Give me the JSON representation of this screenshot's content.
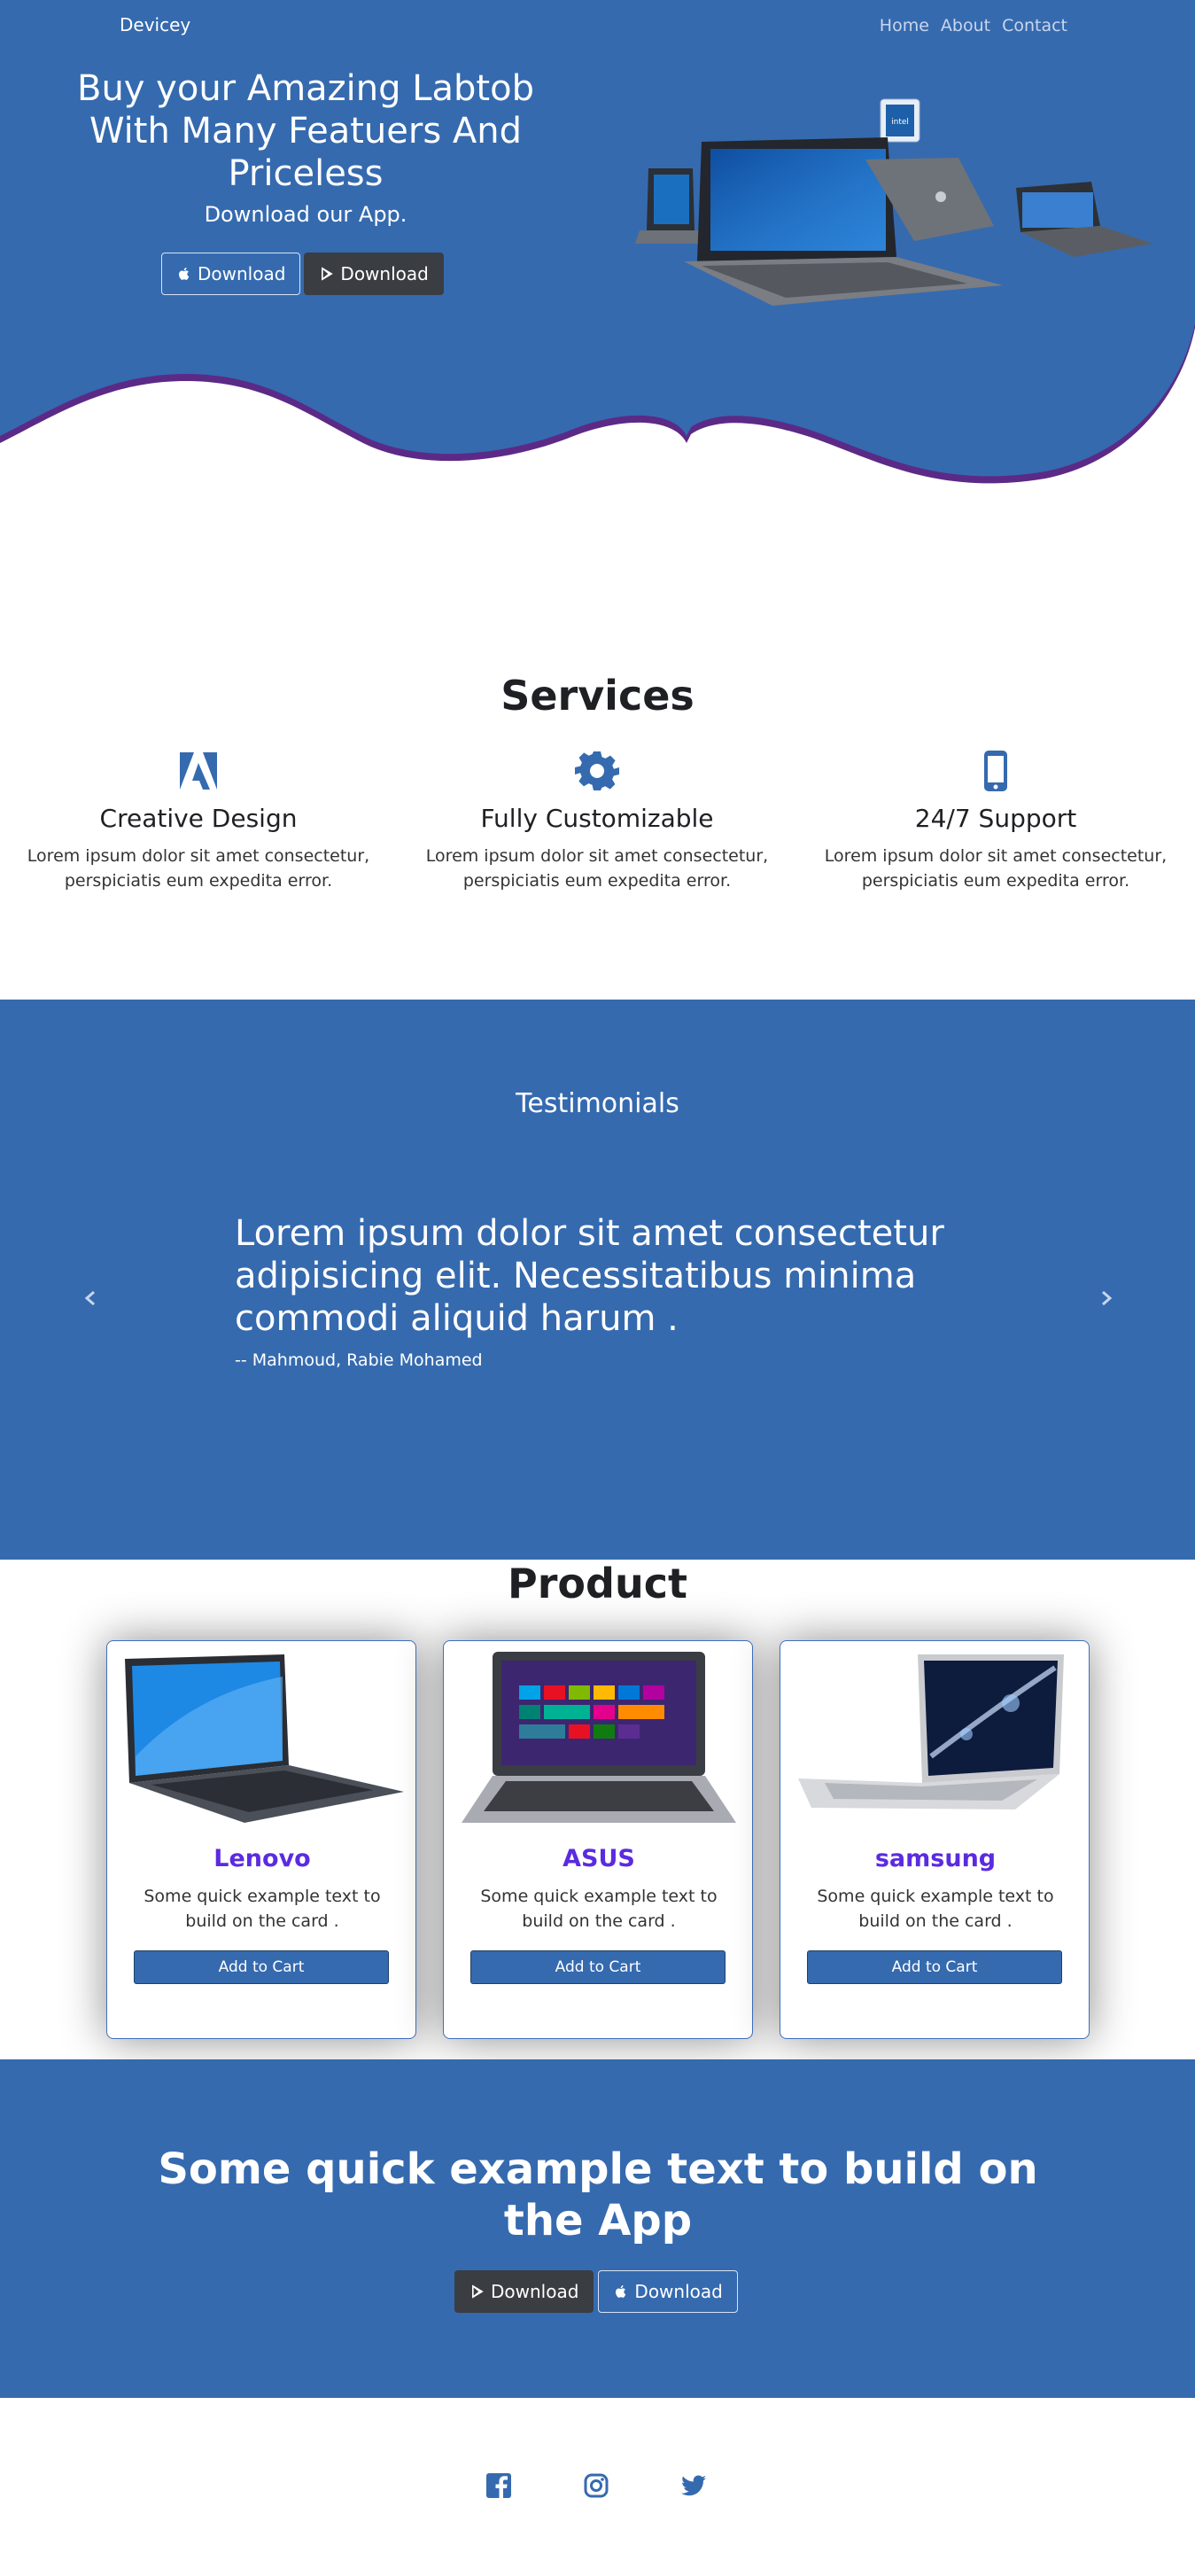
{
  "colors": {
    "primary_blue": "#356aaf",
    "dark_button": "#3a3d42",
    "product_name": "#5b2be0",
    "text_dark": "#1f2024"
  },
  "nav": {
    "brand": "Devicey",
    "links": [
      "Home",
      "About",
      "Contact"
    ]
  },
  "hero": {
    "title": "Buy your Amazing Labtob With Many Featuers And Priceless",
    "subtitle": "Download our App.",
    "buttons": [
      {
        "label": "Download",
        "icon": "apple-icon"
      },
      {
        "label": "Download",
        "icon": "play-store-icon"
      }
    ],
    "image_icon": "laptops-image"
  },
  "services": {
    "title": "Services",
    "items": [
      {
        "icon": "adobe-icon",
        "title": "Creative Design",
        "text": "Lorem ipsum dolor sit amet consectetur, perspiciatis eum expedita error."
      },
      {
        "icon": "gear-icon",
        "title": "Fully Customizable",
        "text": "Lorem ipsum dolor sit amet consectetur, perspiciatis eum expedita error."
      },
      {
        "icon": "mobile-phone-icon",
        "title": "24/7 Support",
        "text": "Lorem ipsum dolor sit amet consectetur, perspiciatis eum expedita error."
      }
    ]
  },
  "testimonials": {
    "title": "Testimonials",
    "quote": "Lorem ipsum dolor sit amet consectetur adipisicing elit. Necessitatibus minima commodi aliquid harum .",
    "author": "-- Mahmoud, Rabie Mohamed"
  },
  "products": {
    "title": "Product",
    "items": [
      {
        "name": "Lenovo",
        "text": "Some quick example text to build on the card .",
        "button": "Add to Cart"
      },
      {
        "name": "ASUS",
        "text": "Some quick example text to build on the card .",
        "button": "Add to Cart"
      },
      {
        "name": "samsung",
        "text": "Some quick example text to build on the card .",
        "button": "Add to Cart"
      }
    ]
  },
  "cta": {
    "title": "Some quick example text to build on the App",
    "buttons": [
      {
        "label": "Download",
        "icon": "play-store-icon"
      },
      {
        "label": "Download",
        "icon": "apple-icon"
      }
    ]
  },
  "footer": {
    "social": [
      "facebook-icon",
      "instagram-icon",
      "twitter-icon"
    ]
  }
}
